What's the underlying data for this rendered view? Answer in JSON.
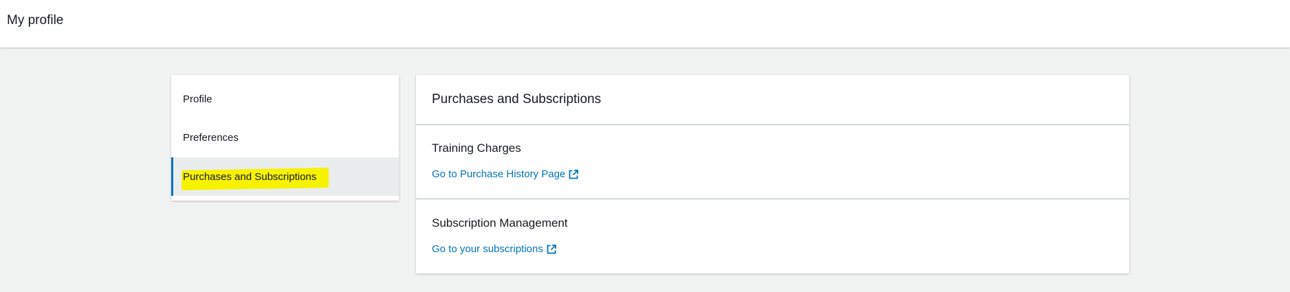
{
  "header": {
    "title": "My profile"
  },
  "sidebar": {
    "items": [
      {
        "label": "Profile",
        "active": false
      },
      {
        "label": "Preferences",
        "active": false
      },
      {
        "label": "Purchases and Subscriptions",
        "active": true
      }
    ]
  },
  "main": {
    "title": "Purchases and Subscriptions",
    "sections": [
      {
        "title": "Training Charges",
        "link_label": "Go to Purchase History Page",
        "link_icon": "external-link-icon"
      },
      {
        "title": "Subscription Management",
        "link_label": "Go to your subscriptions",
        "link_icon": "external-link-icon"
      }
    ]
  },
  "colors": {
    "link": "#0073bb",
    "active_indicator": "#0073bb",
    "highlight": "#f7f200",
    "background": "#f1f2f2"
  }
}
